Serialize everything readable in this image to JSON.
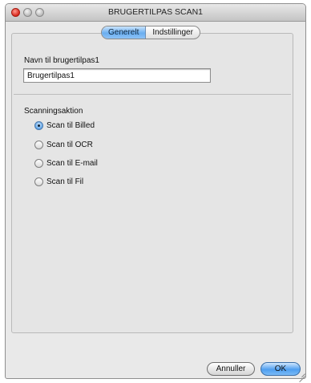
{
  "window": {
    "title": "BRUGERTILPAS SCAN1"
  },
  "tabs": [
    {
      "label": "Generelt",
      "active": true
    },
    {
      "label": "Indstillinger",
      "active": false
    }
  ],
  "form": {
    "name_label": "Navn til brugertilpas1",
    "name_value": "Brugertilpas1"
  },
  "scan_action": {
    "label": "Scanningsaktion",
    "options": [
      {
        "label": "Scan til Billed",
        "selected": true
      },
      {
        "label": "Scan til OCR",
        "selected": false
      },
      {
        "label": "Scan til E-mail",
        "selected": false
      },
      {
        "label": "Scan til Fil",
        "selected": false
      }
    ]
  },
  "buttons": {
    "cancel": "Annuller",
    "ok": "OK"
  },
  "colors": {
    "accent": "#5ea3e8",
    "close": "#d8261b",
    "window_bg": "#e9e9e9"
  },
  "icons": [
    "close-icon",
    "minimize-icon",
    "zoom-icon",
    "resize-grip-icon"
  ]
}
